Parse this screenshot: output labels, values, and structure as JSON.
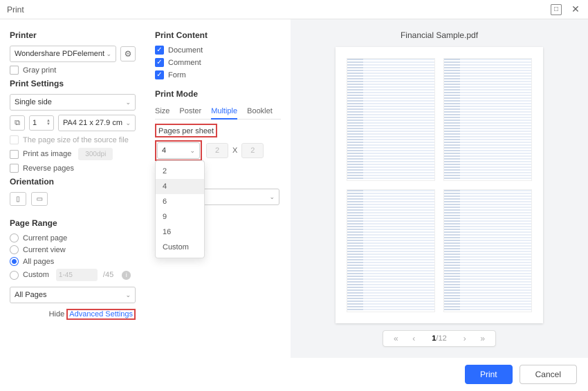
{
  "window": {
    "title": "Print"
  },
  "printer": {
    "section": "Printer",
    "selected": "Wondershare PDFelement",
    "gray_print": "Gray print"
  },
  "print_settings": {
    "section": "Print Settings",
    "side": "Single side",
    "copies": "1",
    "paper": "PA4 21 x 27.9 cm",
    "source_file": "The page size of the source file",
    "print_as_image": "Print as image",
    "dpi": "300dpi",
    "reverse_pages": "Reverse pages"
  },
  "orientation": {
    "section": "Orientation"
  },
  "page_range": {
    "section": "Page Range",
    "current_page": "Current page",
    "current_view": "Current view",
    "all_pages": "All pages",
    "custom": "Custom",
    "custom_placeholder": "1-45",
    "total": "/45",
    "subset": "All Pages",
    "hide": "Hide",
    "advanced": "Advanced Settings"
  },
  "print_content": {
    "section": "Print Content",
    "document": "Document",
    "comment": "Comment",
    "form": "Form"
  },
  "print_mode": {
    "section": "Print Mode",
    "tabs": {
      "size": "Size",
      "poster": "Poster",
      "multiple": "Multiple",
      "booklet": "Booklet"
    },
    "pages_per_sheet": "Pages per sheet",
    "pps_value": "4",
    "dims": {
      "w": "2",
      "h": "2",
      "x": "X"
    },
    "dropdown": {
      "o2": "2",
      "o4": "4",
      "o6": "6",
      "o9": "9",
      "o16": "16",
      "custom": "Custom"
    }
  },
  "preview": {
    "filename": "Financial Sample.pdf",
    "page_current": "1",
    "page_total": "/12"
  },
  "footer": {
    "print": "Print",
    "cancel": "Cancel"
  }
}
